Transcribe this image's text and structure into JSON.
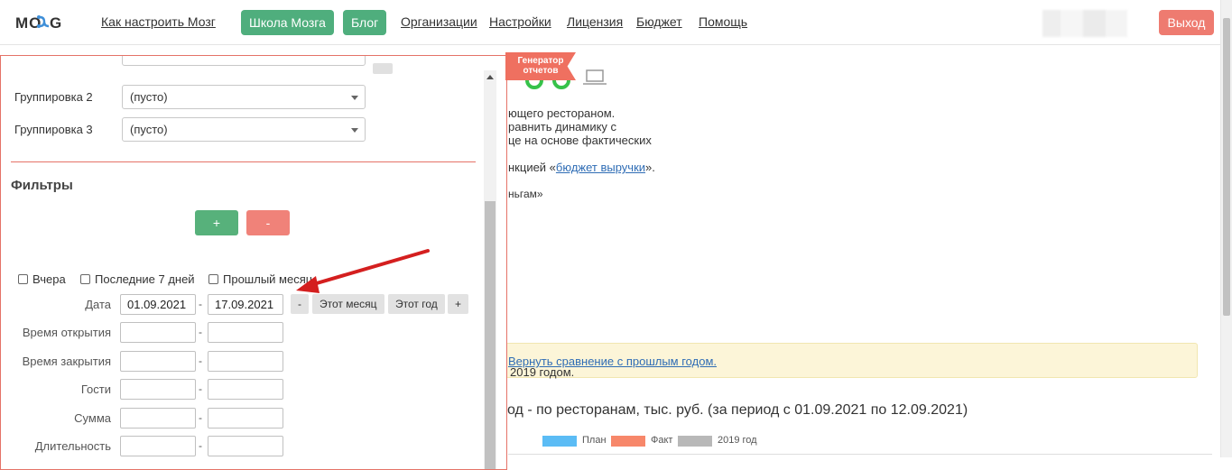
{
  "nav": {
    "logo_text": "MOZG",
    "links": [
      {
        "label": "Как настроить Мозг"
      },
      {
        "label": "Организации"
      },
      {
        "label": "Настройки"
      },
      {
        "label": "Лицензия"
      },
      {
        "label": "Бюджет"
      },
      {
        "label": "Помощь"
      }
    ],
    "school_button": "Школа Мозга",
    "blog_button": "Блог",
    "logout_button": "Выход",
    "accent_green": "#4fae7d",
    "accent_red": "#ee7b70"
  },
  "background": {
    "line1": "ющего рестораном.",
    "line2": "равнить динамику с",
    "line3": "це на основе фактических",
    "line4_prefix": "нкцией «",
    "line4_link": "бюджет выручки",
    "line4_suffix": "».",
    "line5": "ньгам»",
    "notice_text": "2019 годом.",
    "notice_link": "Вернуть сравнение с прошлым годом.",
    "chart_title": "од - по ресторанам, тыс. руб. (за период с 01.09.2021 по 12.09.2021)",
    "legend": [
      {
        "label": "План",
        "color": "#5bbcf5"
      },
      {
        "label": "Факт",
        "color": "#f7876a"
      },
      {
        "label": "2019 год",
        "color": "#b8b8b8"
      }
    ]
  },
  "generator_tag": {
    "line1": "Генератор",
    "line2": "отчетов"
  },
  "panel": {
    "grouping2_label": "Группировка 2",
    "grouping2_value": "(пусто)",
    "grouping3_label": "Группировка 3",
    "grouping3_value": "(пусто)",
    "filters_title": "Фильтры",
    "add_button": "+",
    "remove_button": "-",
    "quick": [
      {
        "label": "Вчера"
      },
      {
        "label": "Последние 7 дней"
      },
      {
        "label": "Прошлый месяц"
      }
    ],
    "date_label": "Дата",
    "date_from": "01.09.2021",
    "date_to": "17.09.2021",
    "date_minus": "-",
    "this_month": "Этот месяц",
    "this_year": "Этот год",
    "date_plus": "+",
    "fields": [
      {
        "label": "Время открытия"
      },
      {
        "label": "Время закрытия"
      },
      {
        "label": "Гости"
      },
      {
        "label": "Сумма"
      },
      {
        "label": "Длительность"
      }
    ],
    "range_dash": "-"
  }
}
